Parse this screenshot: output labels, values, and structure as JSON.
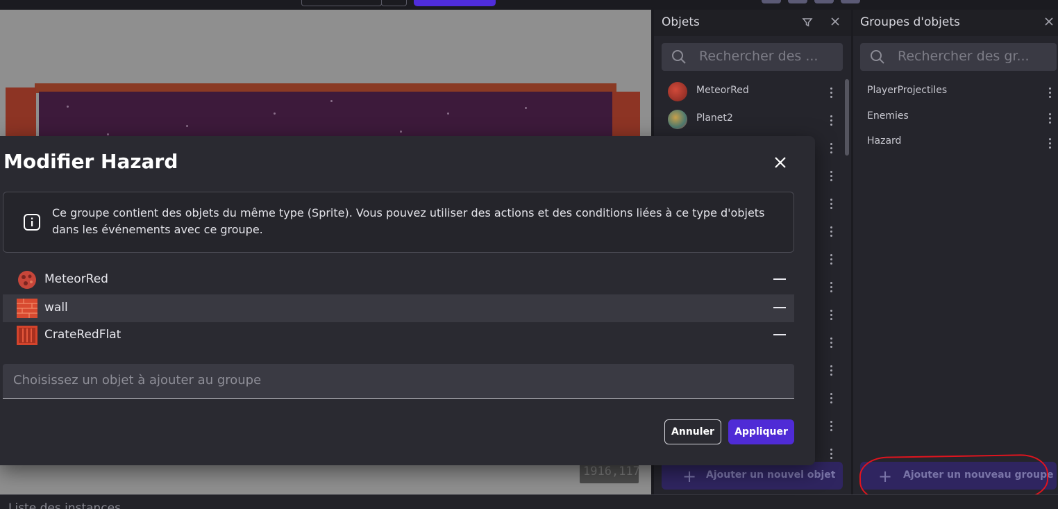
{
  "objects_panel": {
    "title": "Objets",
    "filter_icon": "filter-icon",
    "close_icon": "close-icon",
    "search_placeholder": "Rechercher des ...",
    "items": [
      {
        "name": "MeteorRed",
        "icon": "meteor-icon"
      },
      {
        "name": "Planet2",
        "icon": "planet-icon"
      }
    ],
    "add_button_label": "Ajouter un nouvel objet"
  },
  "groups_panel": {
    "title": "Groupes d'objets",
    "close_icon": "close-icon",
    "search_placeholder": "Rechercher des gr...",
    "groups": [
      {
        "name": "PlayerProjectiles"
      },
      {
        "name": "Enemies"
      },
      {
        "name": "Hazard"
      }
    ],
    "add_button_label": "Ajouter un nouveau groupe"
  },
  "canvas": {
    "coordinates": "1916,117"
  },
  "bottom_panel": {
    "title": "Liste des instances"
  },
  "dialog": {
    "title": "Modifier Hazard",
    "info_text": "Ce groupe contient des objets du même type (Sprite). Vous pouvez utiliser des actions et des conditions liées à ce type d'objets dans les événements avec ce groupe.",
    "members": [
      {
        "name": "MeteorRed",
        "icon": "meteor-icon"
      },
      {
        "name": "wall",
        "icon": "brick-wall-icon"
      },
      {
        "name": "CrateRedFlat",
        "icon": "crate-icon"
      }
    ],
    "add_object_placeholder": "Choisissez un objet à ajouter au groupe",
    "cancel_label": "Annuler",
    "apply_label": "Appliquer"
  },
  "colors": {
    "accent": "#4f2bd6",
    "annotation": "#e0141e"
  }
}
